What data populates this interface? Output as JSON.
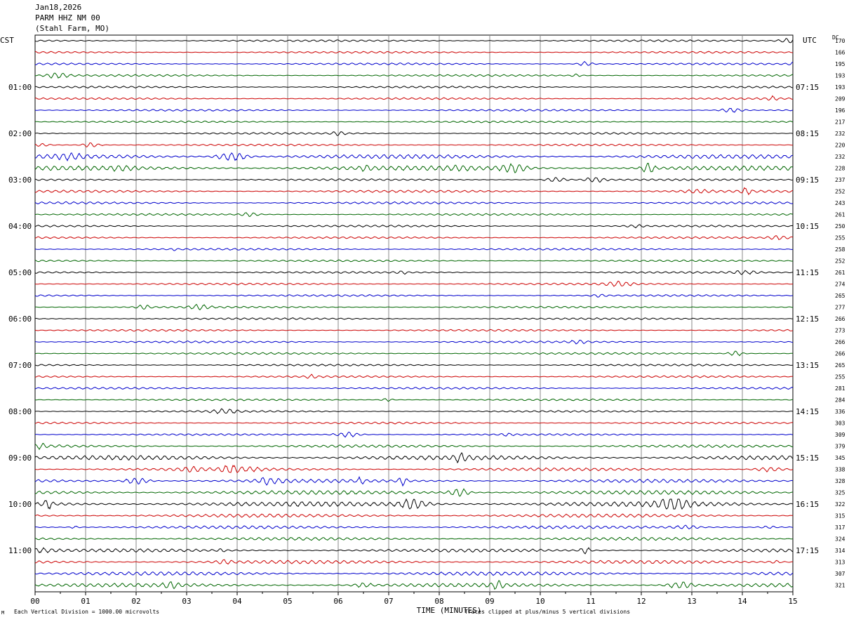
{
  "header": {
    "date": "Jan18,2026",
    "station": "PARM HHZ NM 00",
    "location": "(Stahl Farm, MO)"
  },
  "left_tz": "CST",
  "right_tz": "UTC",
  "dc_label": "DC",
  "footer": {
    "scale_note": "Each Vertical Division = 1000.00 microvolts",
    "clip_note": "Traces clipped at plus/minus 5 vertical divisions",
    "corner_mark": "M"
  },
  "colors": {
    "black": "#000000",
    "red": "#cc0000",
    "blue": "#0000cc",
    "green": "#006600",
    "grid": "#888888"
  },
  "chart_data": {
    "type": "line",
    "xlabel": "TIME (MINUTES)",
    "xlim": [
      0,
      15
    ],
    "x_ticks": [
      "00",
      "01",
      "02",
      "03",
      "04",
      "05",
      "06",
      "07",
      "08",
      "09",
      "10",
      "11",
      "12",
      "13",
      "14",
      "15"
    ],
    "trace_colors": [
      "black",
      "red",
      "blue",
      "green"
    ],
    "left_hour_labels": [
      "01:00",
      "02:00",
      "03:00",
      "04:00",
      "05:00",
      "06:00",
      "07:00",
      "08:00",
      "09:00",
      "10:00",
      "11:00"
    ],
    "right_hour_labels": [
      "07:15",
      "08:15",
      "09:15",
      "10:15",
      "11:15",
      "12:15",
      "13:15",
      "14:15",
      "15:15",
      "16:15",
      "17:15"
    ],
    "dc_offsets": [
      "170",
      "166",
      "195",
      "193",
      "193",
      "209",
      "196",
      "217",
      "232",
      "220",
      "232",
      "228",
      "237",
      "252",
      "243",
      "261",
      "250",
      "255",
      "258",
      "252",
      "261",
      "274",
      "265",
      "277",
      "266",
      "273",
      "266",
      "266",
      "265",
      "255",
      "281",
      "284",
      "336",
      "303",
      "309",
      "379",
      "345",
      "338",
      "328",
      "325",
      "322",
      "315",
      "317",
      "324",
      "314",
      "313",
      "307",
      "321"
    ],
    "noise_level": [
      1,
      1,
      1,
      1,
      1,
      1,
      1,
      1,
      1,
      1,
      2.2,
      2.4,
      1,
      1.3,
      1.2,
      1,
      1,
      1,
      1,
      1,
      1,
      1,
      1,
      1,
      1,
      1,
      1,
      1,
      1,
      1,
      1,
      1,
      1,
      1,
      1,
      1.4,
      2.4,
      1.6,
      1.8,
      2.2,
      2.6,
      1.8,
      1.6,
      1.6,
      1.8,
      1.8,
      2,
      2
    ]
  }
}
